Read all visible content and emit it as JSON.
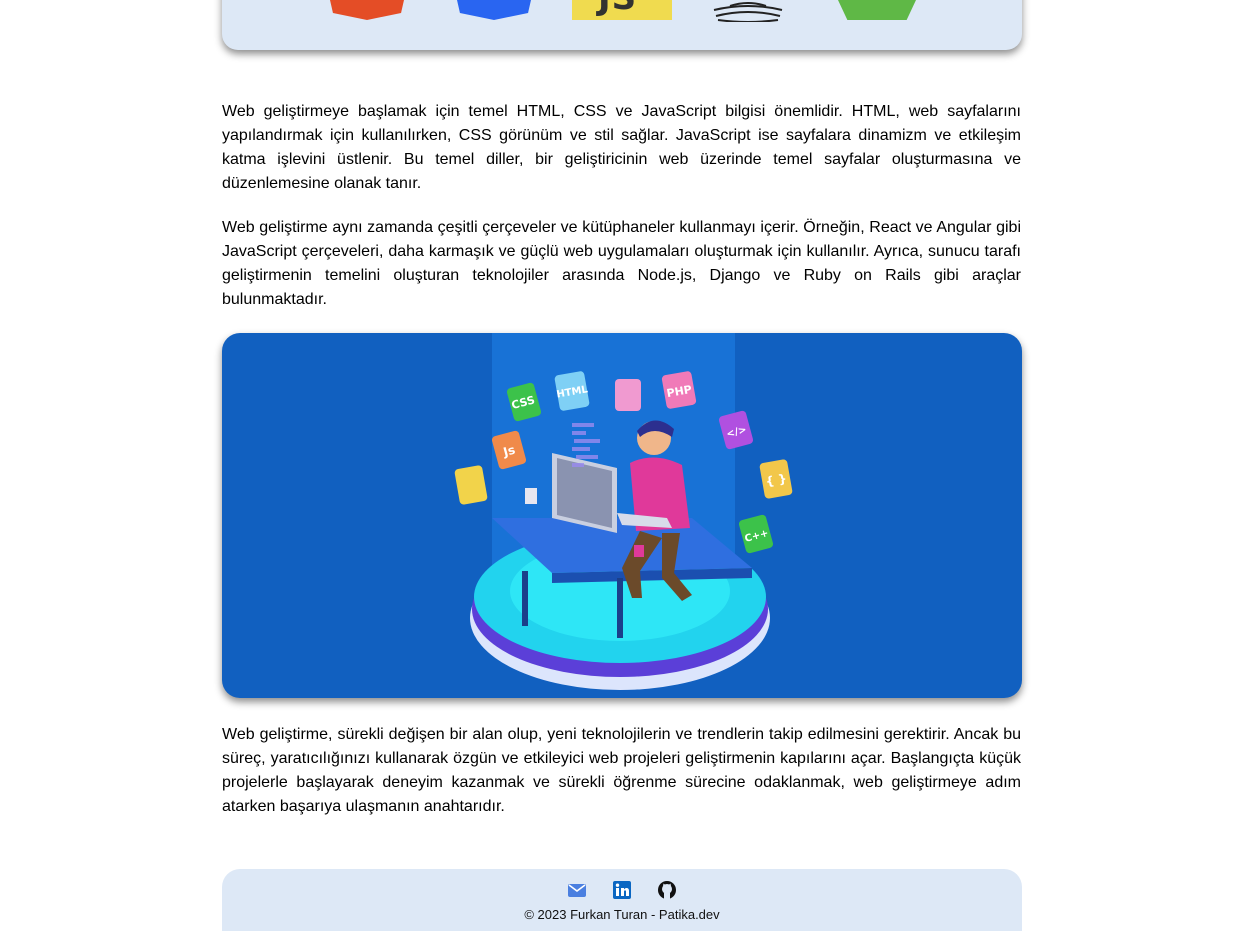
{
  "tech_logos": [
    {
      "icon": "html5-logo-icon"
    },
    {
      "icon": "css3-logo-icon"
    },
    {
      "icon": "javascript-logo-icon",
      "text": "JS"
    },
    {
      "icon": "java-logo-icon"
    },
    {
      "icon": "nodejs-logo-icon"
    }
  ],
  "content": {
    "paragraphs": [
      "Web geliştirmeye başlamak için temel HTML, CSS ve JavaScript bilgisi önemlidir. HTML, web sayfalarını yapılandırmak için kullanılırken, CSS görünüm ve stil sağlar. JavaScript ise sayfalara dinamizm ve etkileşim katma işlevini üstlenir. Bu temel diller, bir geliştiricinin web üzerinde temel sayfalar oluşturmasına ve düzenlemesine olanak tanır.",
      "Web geliştirme aynı zamanda çeşitli çerçeveler ve kütüphaneler kullanmayı içerir. Örneğin, React ve Angular gibi JavaScript çerçeveleri, daha karmaşık ve güçlü web uygulamaları oluşturmak için kullanılır. Ayrıca, sunucu tarafı geliştirmenin temelini oluşturan teknolojiler arasında Node.js, Django ve Ruby on Rails gibi araçlar bulunmaktadır.",
      "Web geliştirme, sürekli değişen bir alan olup, yeni teknolojilerin ve trendlerin takip edilmesini gerektirir. Ancak bu süreç, yaratıcılığınızı kullanarak özgün ve etkileyici web projeleri geliştirmenin kapılarını açar. Başlangıçta küçük projelerle başlayarak deneyim kazanmak ve sürekli öğrenme sürecine odaklanmak, web geliştirmeye adım atarken başarıya ulaşmanın anahtarıdır."
    ]
  },
  "hero": {
    "icon": "developer-illustration",
    "tile_labels": [
      "CSS",
      "HTML",
      "PHP",
      "Js",
      "</>",
      "{ }",
      "C++"
    ]
  },
  "footer": {
    "icons": [
      "mail-icon",
      "linkedin-icon",
      "github-icon"
    ],
    "copyright": "© 2023 Furkan Turan - Patika.dev"
  },
  "colors": {
    "bar_background": "#dde8f6",
    "hero_background": "#1160c0",
    "html": "#e44d26",
    "css": "#2965f1",
    "js": "#f0db4f",
    "node": "#5fb846",
    "mail": "#4a7fe0",
    "linkedin": "#0a66c2",
    "github": "#000000"
  }
}
